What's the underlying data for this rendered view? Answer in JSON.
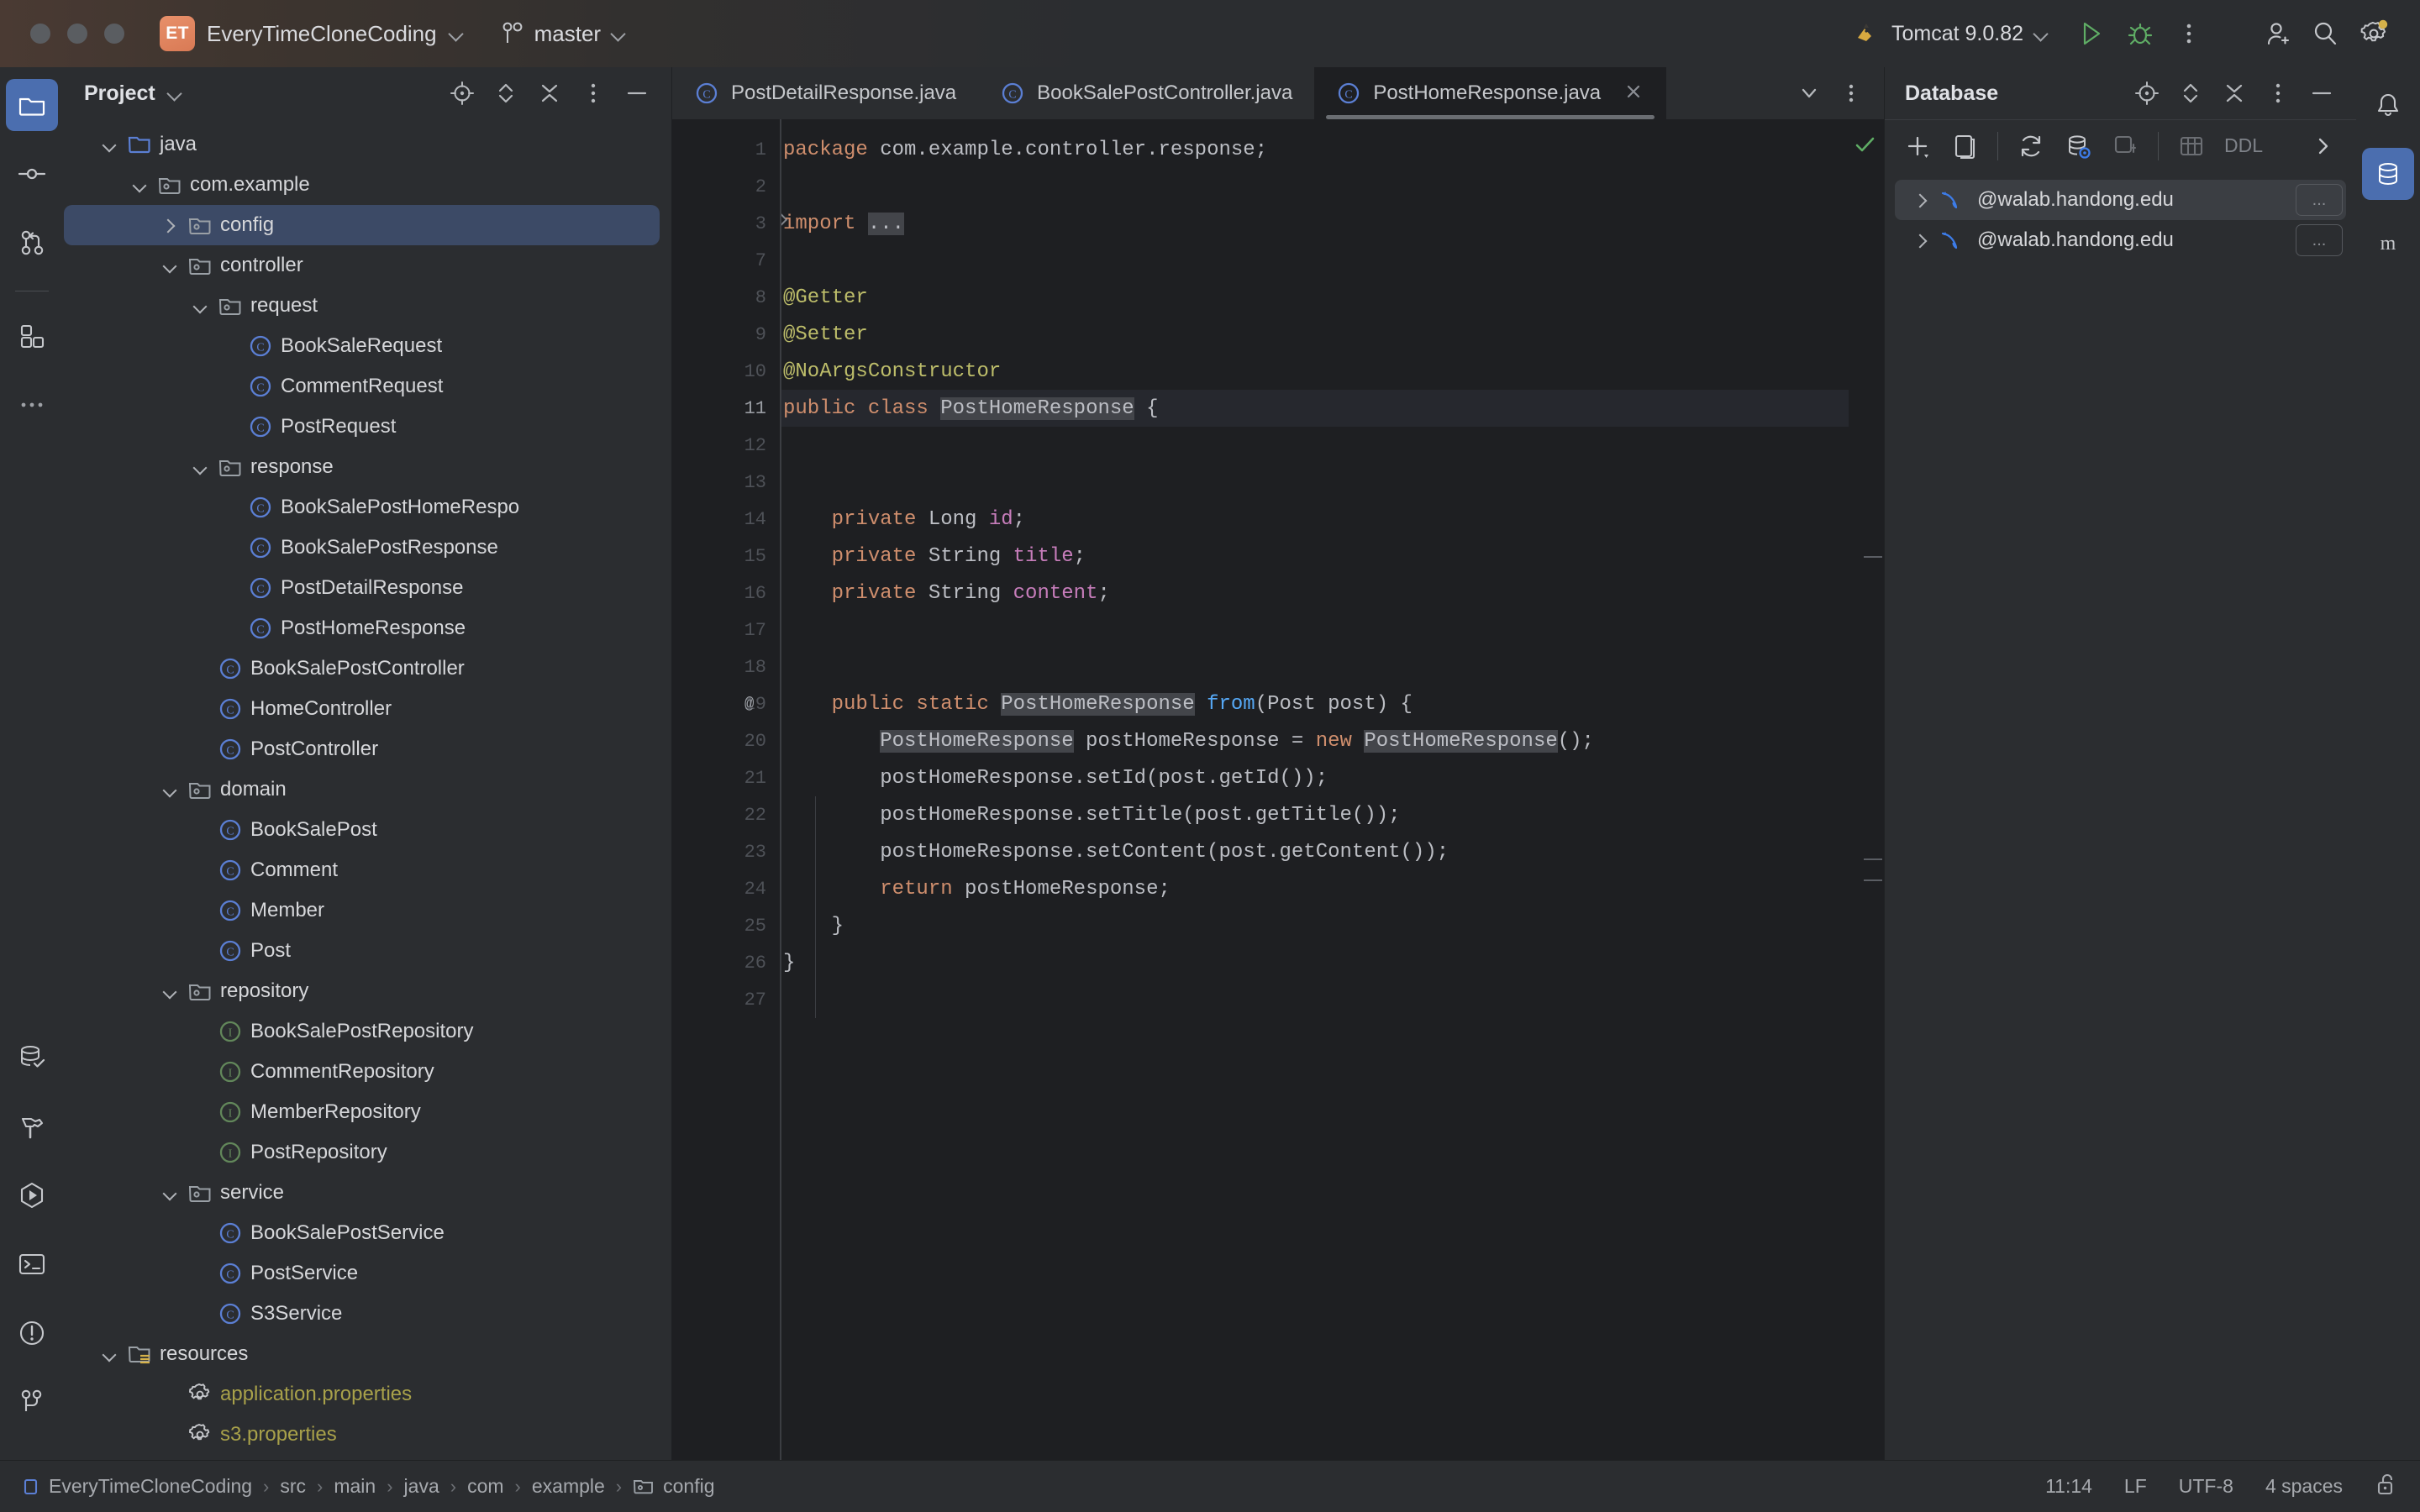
{
  "titlebar": {
    "project_badge": "ET",
    "project_name": "EveryTimeCloneCoding",
    "branch": "master",
    "run_config": "Tomcat 9.0.82",
    "icons": {
      "run": "run-icon",
      "debug": "debug-icon",
      "more": "more-vertical-icon",
      "account": "add-account-icon",
      "search": "search-icon",
      "settings": "settings-icon"
    }
  },
  "left_rail": {
    "items": [
      {
        "name": "project-tool-window",
        "icon": "folder-icon",
        "active": true
      },
      {
        "name": "commit-tool-window",
        "icon": "commit-icon",
        "active": false
      },
      {
        "name": "pull-requests-tool-window",
        "icon": "pull-request-icon",
        "active": false
      },
      {
        "name": "plugins-tool-window",
        "icon": "plugins-icon",
        "active": false
      },
      {
        "name": "more-tool-windows",
        "icon": "more-horizontal-icon",
        "active": false
      }
    ],
    "bottom_items": [
      {
        "name": "database-tool-window",
        "icon": "database-check-icon"
      },
      {
        "name": "build-tool-window",
        "icon": "hammer-icon"
      },
      {
        "name": "run-tool-window",
        "icon": "run-hex-icon"
      },
      {
        "name": "terminal-tool-window",
        "icon": "terminal-icon"
      },
      {
        "name": "problems-tool-window",
        "icon": "warning-circle-icon"
      },
      {
        "name": "git-tool-window",
        "icon": "git-branch-icon"
      }
    ]
  },
  "project_panel": {
    "title": "Project",
    "actions": [
      "locate-icon",
      "expand-collapse-icon",
      "collapse-all-icon",
      "options-icon",
      "hide-icon"
    ],
    "tree": [
      {
        "label": "java",
        "indent": 2,
        "icon": "folder-source-icon",
        "twist": "open",
        "selected": false
      },
      {
        "label": "com.example",
        "indent": 3,
        "icon": "package-icon",
        "twist": "open",
        "selected": false
      },
      {
        "label": "config",
        "indent": 4,
        "icon": "package-icon",
        "twist": "closed",
        "selected": true
      },
      {
        "label": "controller",
        "indent": 4,
        "icon": "package-icon",
        "twist": "open",
        "selected": false
      },
      {
        "label": "request",
        "indent": 5,
        "icon": "package-icon",
        "twist": "open",
        "selected": false
      },
      {
        "label": "BookSaleRequest",
        "indent": 6,
        "icon": "class-icon",
        "twist": "none",
        "selected": false
      },
      {
        "label": "CommentRequest",
        "indent": 6,
        "icon": "class-icon",
        "twist": "none",
        "selected": false
      },
      {
        "label": "PostRequest",
        "indent": 6,
        "icon": "class-icon",
        "twist": "none",
        "selected": false
      },
      {
        "label": "response",
        "indent": 5,
        "icon": "package-icon",
        "twist": "open",
        "selected": false
      },
      {
        "label": "BookSalePostHomeRespo",
        "indent": 6,
        "icon": "class-icon",
        "twist": "none",
        "selected": false
      },
      {
        "label": "BookSalePostResponse",
        "indent": 6,
        "icon": "class-icon",
        "twist": "none",
        "selected": false
      },
      {
        "label": "PostDetailResponse",
        "indent": 6,
        "icon": "class-icon",
        "twist": "none",
        "selected": false
      },
      {
        "label": "PostHomeResponse",
        "indent": 6,
        "icon": "class-icon",
        "twist": "none",
        "selected": false
      },
      {
        "label": "BookSalePostController",
        "indent": 5,
        "icon": "class-icon",
        "twist": "none",
        "selected": false
      },
      {
        "label": "HomeController",
        "indent": 5,
        "icon": "class-icon",
        "twist": "none",
        "selected": false
      },
      {
        "label": "PostController",
        "indent": 5,
        "icon": "class-icon",
        "twist": "none",
        "selected": false
      },
      {
        "label": "domain",
        "indent": 4,
        "icon": "package-icon",
        "twist": "open",
        "selected": false
      },
      {
        "label": "BookSalePost",
        "indent": 5,
        "icon": "class-icon",
        "twist": "none",
        "selected": false
      },
      {
        "label": "Comment",
        "indent": 5,
        "icon": "class-icon",
        "twist": "none",
        "selected": false
      },
      {
        "label": "Member",
        "indent": 5,
        "icon": "class-icon",
        "twist": "none",
        "selected": false
      },
      {
        "label": "Post",
        "indent": 5,
        "icon": "class-icon",
        "twist": "none",
        "selected": false
      },
      {
        "label": "repository",
        "indent": 4,
        "icon": "package-icon",
        "twist": "open",
        "selected": false
      },
      {
        "label": "BookSalePostRepository",
        "indent": 5,
        "icon": "interface-icon",
        "twist": "none",
        "selected": false
      },
      {
        "label": "CommentRepository",
        "indent": 5,
        "icon": "interface-icon",
        "twist": "none",
        "selected": false
      },
      {
        "label": "MemberRepository",
        "indent": 5,
        "icon": "interface-icon",
        "twist": "none",
        "selected": false
      },
      {
        "label": "PostRepository",
        "indent": 5,
        "icon": "interface-icon",
        "twist": "none",
        "selected": false
      },
      {
        "label": "service",
        "indent": 4,
        "icon": "package-icon",
        "twist": "open",
        "selected": false
      },
      {
        "label": "BookSalePostService",
        "indent": 5,
        "icon": "class-icon",
        "twist": "none",
        "selected": false
      },
      {
        "label": "PostService",
        "indent": 5,
        "icon": "class-icon",
        "twist": "none",
        "selected": false
      },
      {
        "label": "S3Service",
        "indent": 5,
        "icon": "class-icon",
        "twist": "none",
        "selected": false
      },
      {
        "label": "resources",
        "indent": 2,
        "icon": "folder-resources-icon",
        "twist": "open",
        "selected": false
      },
      {
        "label": "application.properties",
        "indent": 4,
        "icon": "properties-icon",
        "twist": "none",
        "selected": false,
        "style": "prop"
      },
      {
        "label": "s3.properties",
        "indent": 4,
        "icon": "properties-icon",
        "twist": "none",
        "selected": false,
        "style": "prop"
      }
    ]
  },
  "editor": {
    "tabs": [
      {
        "label": "PostDetailResponse.java",
        "icon": "class-icon",
        "active": false
      },
      {
        "label": "BookSalePostController.java",
        "icon": "class-icon",
        "active": false
      },
      {
        "label": "PostHomeResponse.java",
        "icon": "class-icon",
        "active": true,
        "closable": true
      }
    ],
    "tab_actions": [
      "chevron-down-icon",
      "more-vertical-icon"
    ],
    "lines": [
      {
        "num": "1",
        "mark": "",
        "fold": false,
        "hl": false,
        "tokens": [
          {
            "t": "package ",
            "c": "kw"
          },
          {
            "t": "com.example.controller.response;",
            "c": "txt"
          }
        ]
      },
      {
        "num": "2",
        "mark": "",
        "fold": false,
        "hl": false,
        "tokens": []
      },
      {
        "num": "3",
        "mark": "",
        "fold": true,
        "hl": false,
        "tokens": [
          {
            "t": "import ",
            "c": "kw"
          },
          {
            "t": "...",
            "c": "ident"
          }
        ]
      },
      {
        "num": "7",
        "mark": "",
        "fold": false,
        "hl": false,
        "tokens": []
      },
      {
        "num": "8",
        "mark": "",
        "fold": false,
        "hl": false,
        "tokens": [
          {
            "t": "@Getter",
            "c": "ann"
          }
        ]
      },
      {
        "num": "9",
        "mark": "",
        "fold": false,
        "hl": false,
        "tokens": [
          {
            "t": "@Setter",
            "c": "ann"
          }
        ]
      },
      {
        "num": "10",
        "mark": "",
        "fold": false,
        "hl": false,
        "tokens": [
          {
            "t": "@NoArgsConstructor",
            "c": "ann"
          }
        ]
      },
      {
        "num": "11",
        "mark": "",
        "fold": false,
        "hl": true,
        "tokens": [
          {
            "t": "public class ",
            "c": "kw"
          },
          {
            "t": "PostHomeResponse",
            "c": "ident"
          },
          {
            "t": " {",
            "c": "txt"
          }
        ]
      },
      {
        "num": "12",
        "mark": "",
        "fold": false,
        "hl": false,
        "tokens": []
      },
      {
        "num": "13",
        "mark": "",
        "fold": false,
        "hl": false,
        "tokens": []
      },
      {
        "num": "14",
        "mark": "",
        "fold": false,
        "hl": false,
        "tokens": [
          {
            "t": "    private ",
            "c": "kw"
          },
          {
            "t": "Long ",
            "c": "txt"
          },
          {
            "t": "id",
            "c": "fld"
          },
          {
            "t": ";",
            "c": "txt"
          }
        ]
      },
      {
        "num": "15",
        "mark": "",
        "fold": false,
        "hl": false,
        "tokens": [
          {
            "t": "    private ",
            "c": "kw"
          },
          {
            "t": "String ",
            "c": "txt"
          },
          {
            "t": "title",
            "c": "fld"
          },
          {
            "t": ";",
            "c": "txt"
          }
        ]
      },
      {
        "num": "16",
        "mark": "",
        "fold": false,
        "hl": false,
        "tokens": [
          {
            "t": "    private ",
            "c": "kw"
          },
          {
            "t": "String ",
            "c": "txt"
          },
          {
            "t": "content",
            "c": "fld"
          },
          {
            "t": ";",
            "c": "txt"
          }
        ]
      },
      {
        "num": "17",
        "mark": "",
        "fold": false,
        "hl": false,
        "tokens": []
      },
      {
        "num": "18",
        "mark": "",
        "fold": false,
        "hl": false,
        "tokens": []
      },
      {
        "num": "19",
        "mark": "@",
        "fold": false,
        "hl": false,
        "tokens": [
          {
            "t": "    public static ",
            "c": "kw"
          },
          {
            "t": "PostHomeResponse",
            "c": "ident"
          },
          {
            "t": " ",
            "c": "txt"
          },
          {
            "t": "from",
            "c": "mth"
          },
          {
            "t": "(Post post) {",
            "c": "txt"
          }
        ]
      },
      {
        "num": "20",
        "mark": "",
        "fold": false,
        "hl": false,
        "tokens": [
          {
            "t": "        ",
            "c": "txt"
          },
          {
            "t": "PostHomeResponse",
            "c": "ident"
          },
          {
            "t": " postHomeResponse = ",
            "c": "txt"
          },
          {
            "t": "new ",
            "c": "kw"
          },
          {
            "t": "PostHomeResponse",
            "c": "ident"
          },
          {
            "t": "();",
            "c": "txt"
          }
        ]
      },
      {
        "num": "21",
        "mark": "",
        "fold": false,
        "hl": false,
        "tokens": [
          {
            "t": "        postHomeResponse.setId(post.getId());",
            "c": "txt"
          }
        ]
      },
      {
        "num": "22",
        "mark": "",
        "fold": false,
        "hl": false,
        "tokens": [
          {
            "t": "        postHomeResponse.setTitle(post.getTitle());",
            "c": "txt"
          }
        ]
      },
      {
        "num": "23",
        "mark": "",
        "fold": false,
        "hl": false,
        "tokens": [
          {
            "t": "        postHomeResponse.setContent(post.getContent());",
            "c": "txt"
          }
        ]
      },
      {
        "num": "24",
        "mark": "",
        "fold": false,
        "hl": false,
        "tokens": [
          {
            "t": "        ",
            "c": "txt"
          },
          {
            "t": "return ",
            "c": "kw"
          },
          {
            "t": "postHomeResponse;",
            "c": "txt"
          }
        ]
      },
      {
        "num": "25",
        "mark": "",
        "fold": false,
        "hl": false,
        "tokens": [
          {
            "t": "    }",
            "c": "txt"
          }
        ]
      },
      {
        "num": "26",
        "mark": "",
        "fold": false,
        "hl": false,
        "tokens": [
          {
            "t": "}",
            "c": "txt"
          }
        ]
      },
      {
        "num": "27",
        "mark": "",
        "fold": false,
        "hl": false,
        "tokens": []
      }
    ]
  },
  "database_panel": {
    "title": "Database",
    "actions": [
      "locate-icon",
      "expand-collapse-icon",
      "collapse-all-icon",
      "options-icon",
      "hide-icon"
    ],
    "toolbar": {
      "add": "add-icon",
      "duplicate": "duplicate-icon",
      "refresh": "refresh-icon",
      "data_source": "data-source-properties-icon",
      "new_query": "new-query-icon",
      "table": "table-icon",
      "ddl_label": "DDL",
      "expand": "chevron-right-icon"
    },
    "connections": [
      {
        "label": "@walab.handong.edu",
        "icon": "mysql-icon",
        "selected": true,
        "more": "..."
      },
      {
        "label": "@walab.handong.edu",
        "icon": "mysql-icon",
        "selected": false,
        "more": "..."
      }
    ]
  },
  "right_rail": {
    "items": [
      {
        "name": "notifications-tool-window",
        "icon": "bell-icon"
      },
      {
        "name": "database-tool-window",
        "icon": "database-icon",
        "active": true
      },
      {
        "name": "maven-tool-window",
        "icon": "maven-icon"
      }
    ]
  },
  "statusbar": {
    "breadcrumb": [
      "EveryTimeCloneCoding",
      "src",
      "main",
      "java",
      "com",
      "example",
      "config"
    ],
    "cursor_position": "11:14",
    "line_separator": "LF",
    "encoding": "UTF-8",
    "indent": "4 spaces",
    "lock_icon": "unlocked-icon"
  }
}
